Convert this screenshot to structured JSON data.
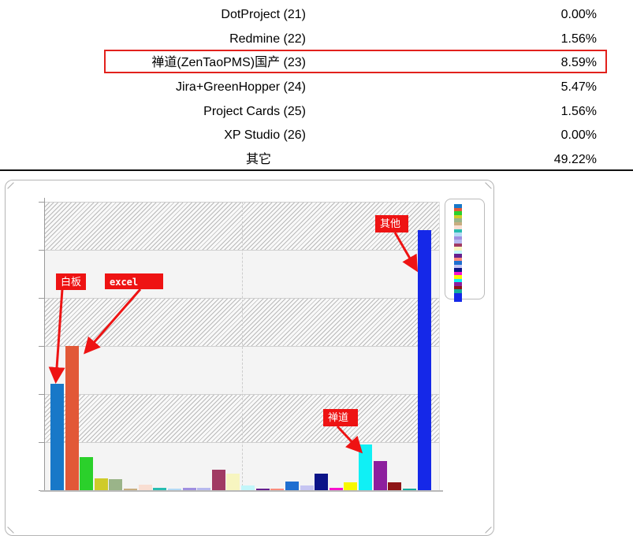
{
  "results_table": {
    "rows": [
      {
        "label": "DotProject (21)",
        "value": "0.00%",
        "highlighted": false
      },
      {
        "label": "Redmine (22)",
        "value": "1.56%",
        "highlighted": false
      },
      {
        "label": "禅道(ZenTaoPMS)国产 (23)",
        "value": "8.59%",
        "highlighted": true
      },
      {
        "label": "Jira+GreenHopper (24)",
        "value": "5.47%",
        "highlighted": false
      },
      {
        "label": "Project Cards (25)",
        "value": "1.56%",
        "highlighted": false
      },
      {
        "label": "XP Studio (26)",
        "value": "0.00%",
        "highlighted": false
      },
      {
        "label": "其它",
        "value": "49.22%",
        "highlighted": false
      }
    ],
    "highlight_border_color": "#e2211c"
  },
  "chart_data": {
    "type": "bar",
    "title": "",
    "xlabel": "",
    "ylabel": "",
    "unit": "percent",
    "ylim": [
      0,
      54.6
    ],
    "gridline_interval_pct": 9.1,
    "grid": "horizontal-alternating-hatched-bands",
    "legend_position": "right",
    "x": [
      1,
      2,
      3,
      4,
      5,
      6,
      7,
      8,
      9,
      10,
      11,
      12,
      13,
      14,
      15,
      16,
      17,
      18,
      19,
      20,
      21,
      22,
      23,
      24,
      25,
      26
    ],
    "values": [
      20.1,
      27.3,
      6.3,
      2.2,
      2.1,
      0.3,
      1.0,
      0.45,
      0.3,
      0.45,
      0.45,
      3.9,
      3.1,
      0.9,
      0.35,
      0.35,
      1.7,
      0.95,
      3.1,
      0.4,
      1.56,
      8.59,
      5.47,
      1.56,
      0.2,
      49.22
    ],
    "colors": [
      "#1878c8",
      "#e25837",
      "#2bd02b",
      "#cfcb2a",
      "#9ab489",
      "#c8ad7f",
      "#f9ded2",
      "#27bdb0",
      "#b3d9f5",
      "#9f8fe0",
      "#b7b9ee",
      "#a13a63",
      "#f7f5c0",
      "#c2f6fa",
      "#651f8e",
      "#f98c7d",
      "#1f6fd0",
      "#c6c5f2",
      "#0c1488",
      "#f712cc",
      "#f8f800",
      "#10f0f5",
      "#8d1f9e",
      "#8e1517",
      "#12ab9d",
      "#1528e8"
    ],
    "annotations": [
      {
        "text": "白板",
        "target_bar_index": 1,
        "approx_value": 20.1
      },
      {
        "text": "excel",
        "target_bar_index": 2,
        "approx_value": 27.3
      },
      {
        "text": "其他",
        "target_bar_index": 26,
        "approx_value": 49.22
      },
      {
        "text": "禅道",
        "target_bar_index": 22,
        "approx_value": 8.59
      }
    ],
    "annotation_color": "#ee1313"
  }
}
